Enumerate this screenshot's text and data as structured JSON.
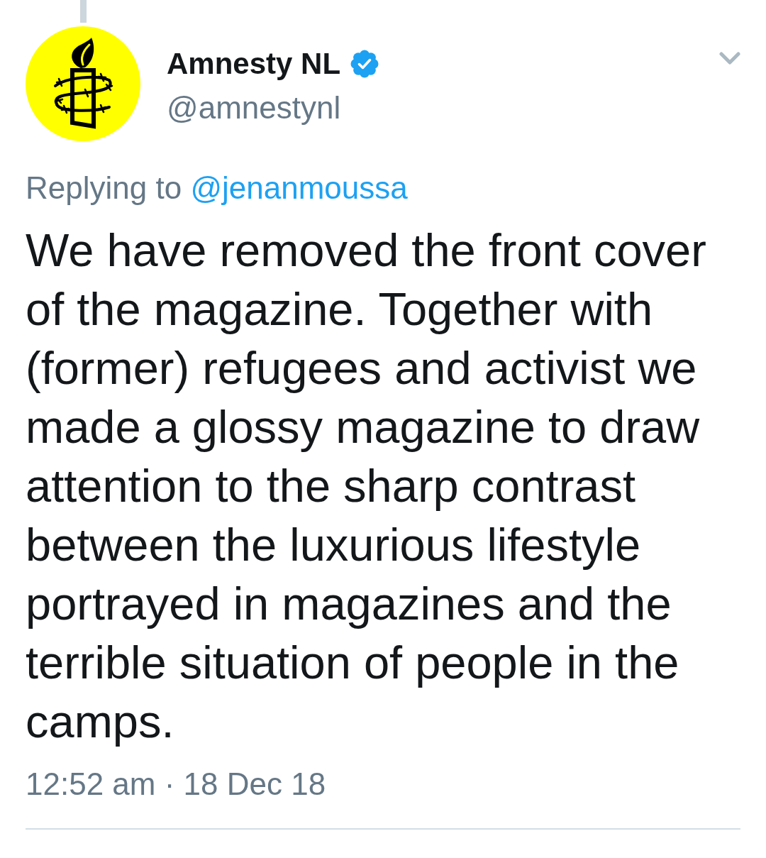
{
  "author": {
    "name": "Amnesty NL",
    "verified": true,
    "handle": "@amnestynl"
  },
  "reply_context": {
    "label": "Replying to",
    "mention": "@jenanmoussa"
  },
  "tweet": {
    "text": "We have removed the front cover of the magazine. Together with (former) refugees and activist we made a glossy magazine to draw attention to the sharp contrast between the luxurious lifestyle portrayed in magazines and the terrible situation of people in the camps.",
    "timestamp": "12:52 am · 18 Dec 18"
  }
}
